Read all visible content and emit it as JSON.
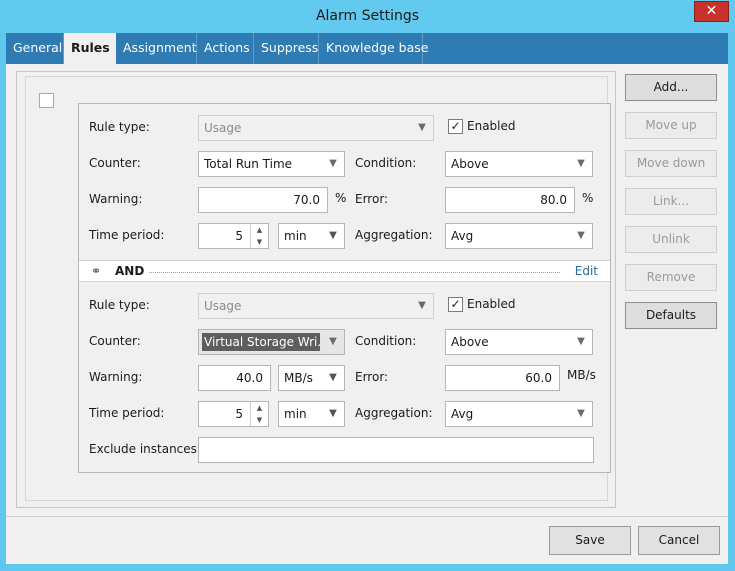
{
  "window": {
    "title": "Alarm Settings",
    "close_symbol": "✕"
  },
  "tabs": [
    {
      "label": "General"
    },
    {
      "label": "Rules"
    },
    {
      "label": "Assignment"
    },
    {
      "label": "Actions"
    },
    {
      "label": "Suppress"
    },
    {
      "label": "Knowledge base"
    }
  ],
  "labels": {
    "rule_type": "Rule type:",
    "counter": "Counter:",
    "warning": "Warning:",
    "time_period": "Time period:",
    "condition": "Condition:",
    "error": "Error:",
    "aggregation": "Aggregation:",
    "enabled": "Enabled",
    "exclude_instances": "Exclude instances:"
  },
  "rule1": {
    "rule_type": "Usage",
    "enabled": true,
    "counter": "Total Run Time",
    "condition": "Above",
    "warning": "70.0",
    "warning_unit": "%",
    "error": "80.0",
    "error_unit": "%",
    "time_period": "5",
    "time_unit": "min",
    "aggregation": "Avg"
  },
  "and_row": {
    "label": "AND",
    "edit": "Edit",
    "icon": "link-icon"
  },
  "rule2": {
    "rule_type": "Usage",
    "enabled": true,
    "counter": "Virtual Storage Wri...",
    "condition": "Above",
    "warning": "40.0",
    "warning_unit": "MB/s",
    "error": "60.0",
    "error_unit": "MB/s",
    "time_period": "5",
    "time_unit": "min",
    "aggregation": "Avg",
    "exclude_instances": ""
  },
  "side_buttons": {
    "add": "Add...",
    "move_up": "Move up",
    "move_down": "Move down",
    "link": "Link...",
    "unlink": "Unlink",
    "remove": "Remove",
    "defaults": "Defaults"
  },
  "dialog_buttons": {
    "save": "Save",
    "cancel": "Cancel"
  },
  "glyphs": {
    "dropdown": "▼",
    "spin_up": "▲",
    "spin_down": "▼",
    "check": "✓",
    "link": "⚭"
  }
}
